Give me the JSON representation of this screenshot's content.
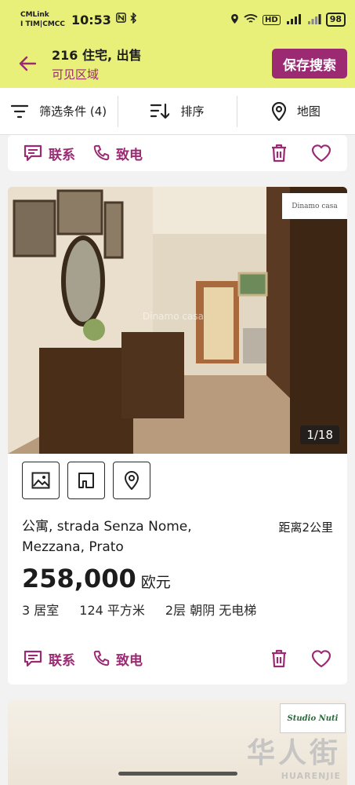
{
  "status_bar": {
    "carrier_line1": "CMLink",
    "carrier_line2": "I TIM|CMCC",
    "time": "10:53",
    "battery": "98"
  },
  "header": {
    "title": "216 住宅, 出售",
    "subtitle": "可见区域",
    "save_search_label": "保存搜索"
  },
  "toolbar": {
    "filter_label": "筛选条件 (4)",
    "sort_label": "排序",
    "map_label": "地图"
  },
  "card_actions": {
    "contact_label": "联系",
    "call_label": "致电"
  },
  "listing": {
    "photo_counter": "1/18",
    "brand": "Dinamo casa",
    "watermark": "Dinamo casa",
    "title": "公寓, strada Senza Nome, Mezzana, Prato",
    "distance": "距离2公里",
    "price": "258,000",
    "currency": "欧元",
    "features": [
      "3 居室",
      "124 平方米",
      "2层 朝阴 无电梯"
    ]
  },
  "next_listing": {
    "brand": "Studio Nuti"
  },
  "site_watermark": {
    "text": "华人街",
    "latin": "HUARENJIE"
  },
  "colors": {
    "accent": "#9b2a73",
    "header_bg": "#e8f079"
  }
}
